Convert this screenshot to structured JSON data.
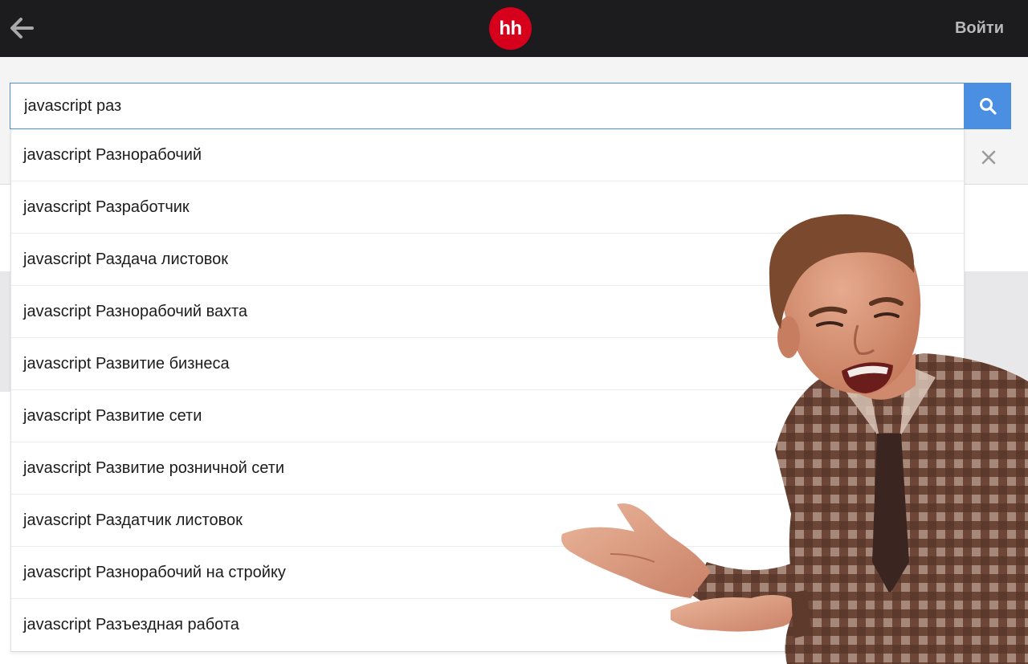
{
  "header": {
    "logo_text": "hh",
    "login_label": "Войти",
    "back_icon": "arrow-left-icon",
    "colors": {
      "background": "#1c1b1d",
      "logo": "#d6001c",
      "login_text": "#b9b9bb"
    }
  },
  "search": {
    "value": "javascript раз",
    "search_icon": "search-icon",
    "clear_icon": "close-icon",
    "colors": {
      "button": "#4a8fe2",
      "border": "#4a90d9"
    }
  },
  "suggestions": [
    {
      "label": "javascript Разнорабочий"
    },
    {
      "label": "javascript Разработчик"
    },
    {
      "label": "javascript Раздача листовок"
    },
    {
      "label": "javascript Разнорабочий вахта"
    },
    {
      "label": "javascript Развитие бизнеса"
    },
    {
      "label": "javascript Развитие сети"
    },
    {
      "label": "javascript Развитие розничной сети"
    },
    {
      "label": "javascript Раздатчик листовок"
    },
    {
      "label": "javascript Разнорабочий на стройку"
    },
    {
      "label": "javascript Разъездная работа"
    }
  ]
}
